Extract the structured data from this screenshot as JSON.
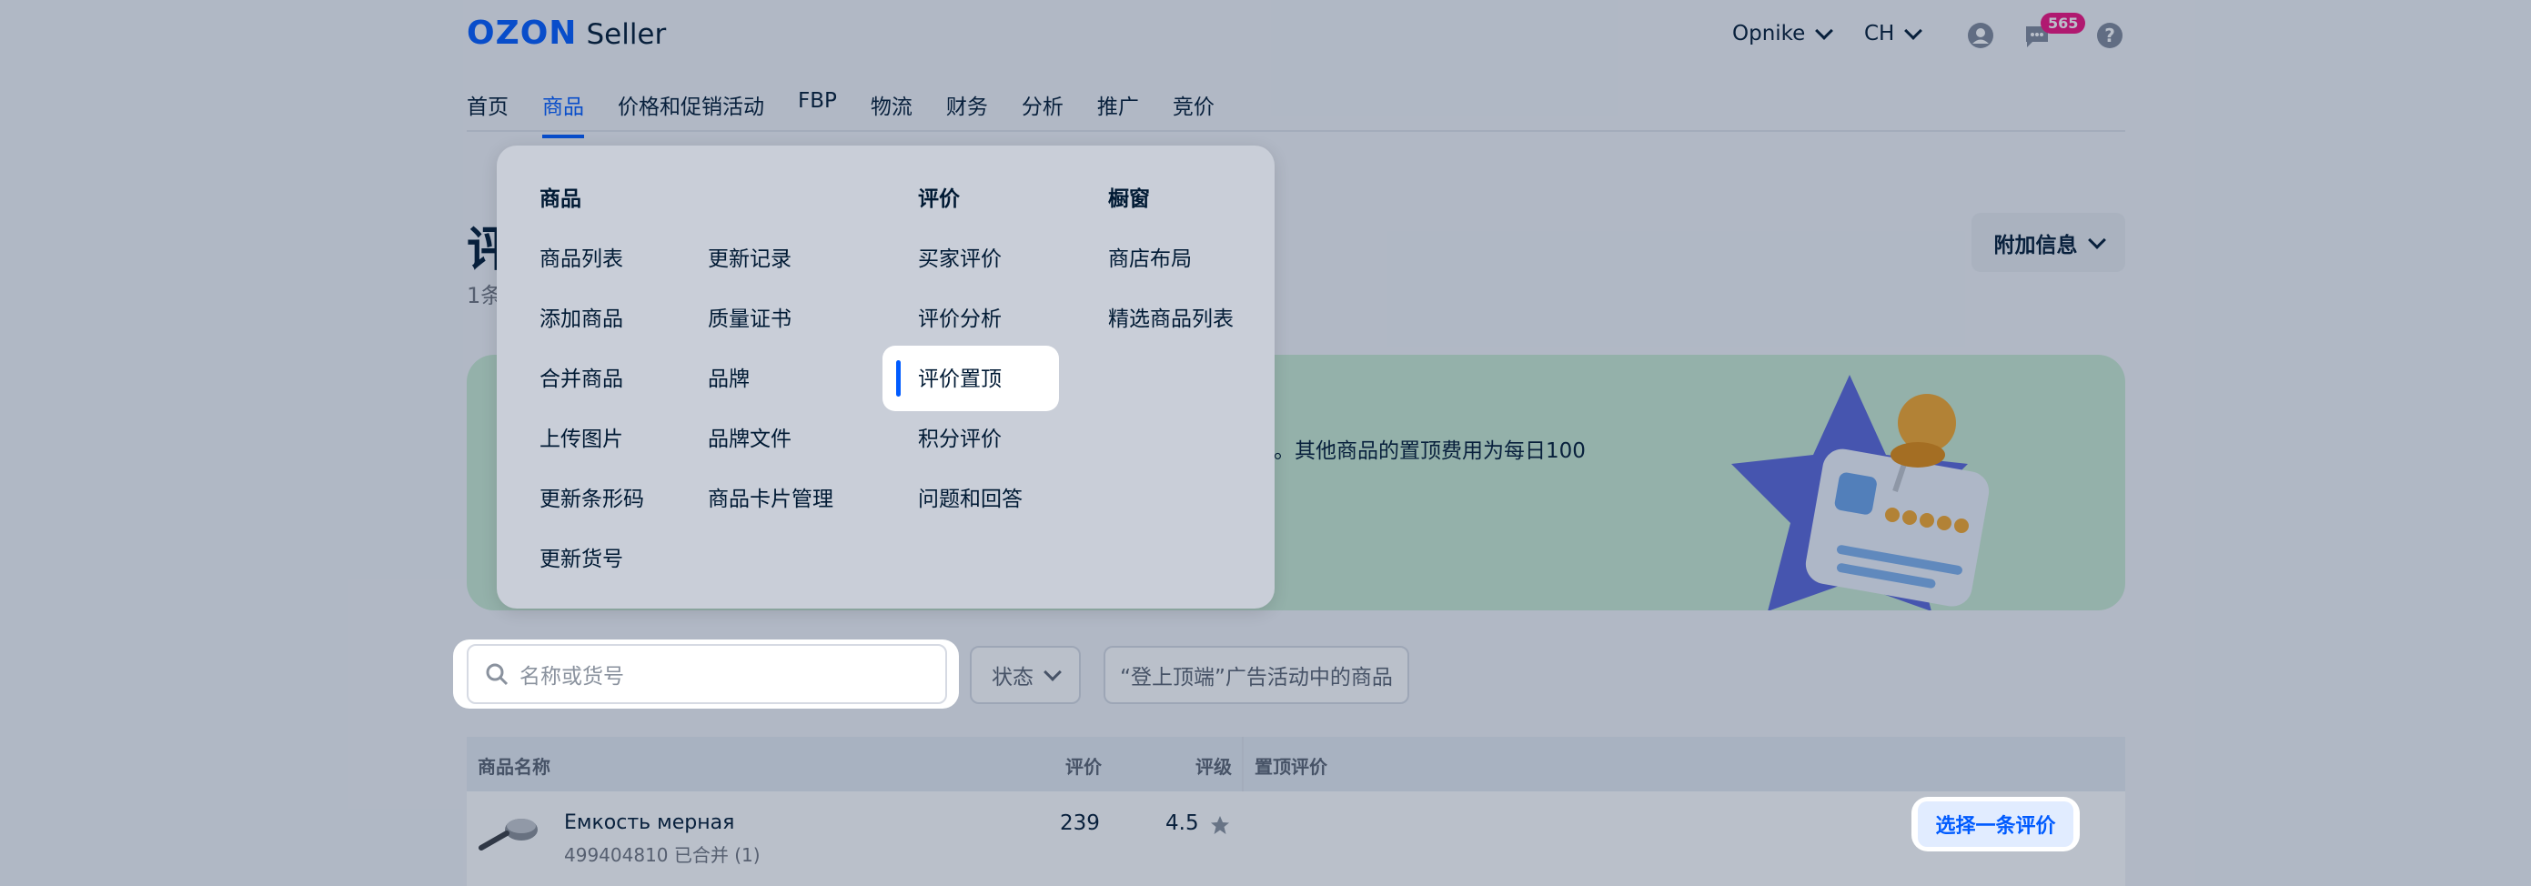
{
  "header": {
    "logo_brand": "OZON",
    "logo_product": "Seller",
    "account_name": "Opnike",
    "language": "CH",
    "notifications_count": "565",
    "icons": [
      "user-icon",
      "chat-icon",
      "help-icon"
    ]
  },
  "nav": {
    "tabs": [
      {
        "label": "首页"
      },
      {
        "label": "商品"
      },
      {
        "label": "价格和促销活动"
      },
      {
        "label": "FBP"
      },
      {
        "label": "物流"
      },
      {
        "label": "财务"
      },
      {
        "label": "分析"
      },
      {
        "label": "推广"
      },
      {
        "label": "竞价"
      }
    ],
    "active_tab": "商品"
  },
  "page": {
    "title_fragment": "评",
    "subtitle_fragment": "1条",
    "extra_info_button": "附加信息",
    "banner_text": "。其他商品的置顶费用为每日100"
  },
  "filters": {
    "search_placeholder": "名称或货号",
    "status_label": "状态",
    "campaign_label": "“登上顶端”广告活动中的商品"
  },
  "table": {
    "headers": [
      "商品名称",
      "评价",
      "评级",
      "置顶评价"
    ],
    "rows": [
      {
        "name": "Емкость мерная",
        "sku_line": "499404810 已合并 (1)",
        "reviews": "239",
        "rating": "4.5",
        "action": "选择一条评价"
      }
    ]
  },
  "menu": {
    "col1_heading": "商品",
    "col1": [
      "商品列表",
      "添加商品",
      "合并商品",
      "上传图片",
      "更新条形码",
      "更新货号"
    ],
    "col2": [
      "更新记录",
      "质量证书",
      "品牌",
      "品牌文件",
      "商品卡片管理"
    ],
    "col3_heading": "评价",
    "col3": [
      "买家评价",
      "评价分析",
      "评价置顶",
      "积分评价",
      "问题和回答"
    ],
    "col4_heading": "橱窗",
    "col4": [
      "商店布局",
      "精选商品列表"
    ],
    "highlighted_item": "评价置顶"
  },
  "colors": {
    "accent": "#005bff",
    "badge": "#f1117e",
    "banner": "#c9ead1",
    "star": "#5a66d8"
  }
}
